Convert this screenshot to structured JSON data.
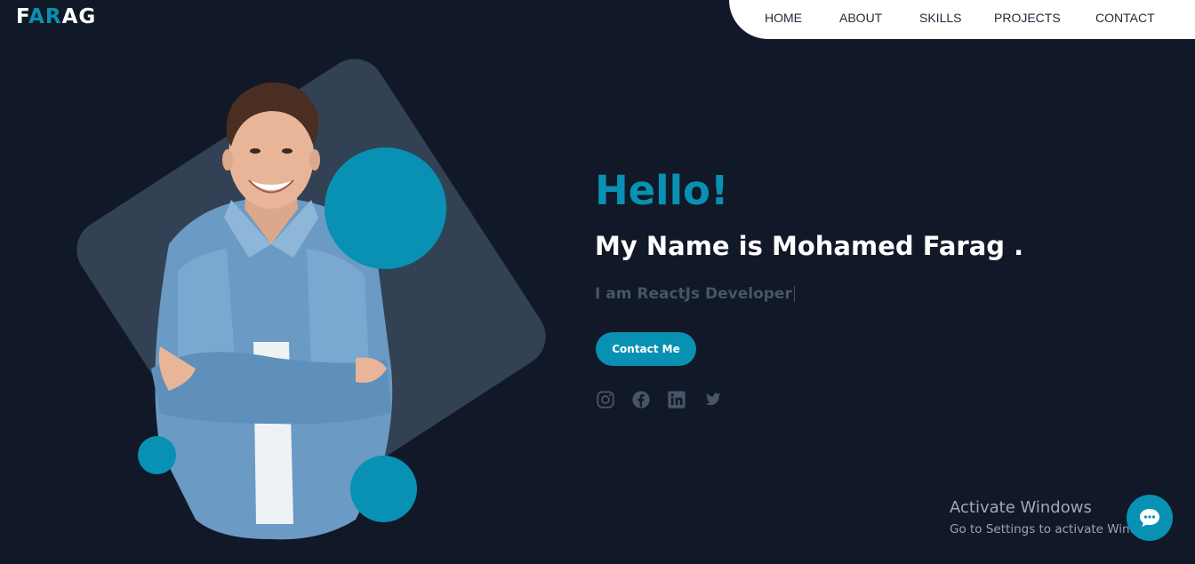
{
  "logo": {
    "part1": "F",
    "part2": "AR",
    "part3": "AG"
  },
  "nav": {
    "items": [
      {
        "label": "HOME"
      },
      {
        "label": "ABOUT"
      },
      {
        "label": "SKILLS"
      },
      {
        "label": "PROJECTS"
      },
      {
        "label": "CONTACT"
      }
    ]
  },
  "hero": {
    "greeting": "Hello!",
    "name_line": "My Name is Mohamed Farag .",
    "role_line": "I am ReactJs Developer",
    "cta_label": "Contact Me",
    "socials": [
      {
        "icon": "instagram-icon"
      },
      {
        "icon": "facebook-icon"
      },
      {
        "icon": "linkedin-icon"
      },
      {
        "icon": "twitter-icon"
      }
    ]
  },
  "watermark": {
    "title": "Activate Windows",
    "subtitle": "Go to Settings to activate Windows."
  },
  "colors": {
    "background": "#111827",
    "accent": "#0891b2",
    "tile": "#334155",
    "muted": "#475569"
  }
}
